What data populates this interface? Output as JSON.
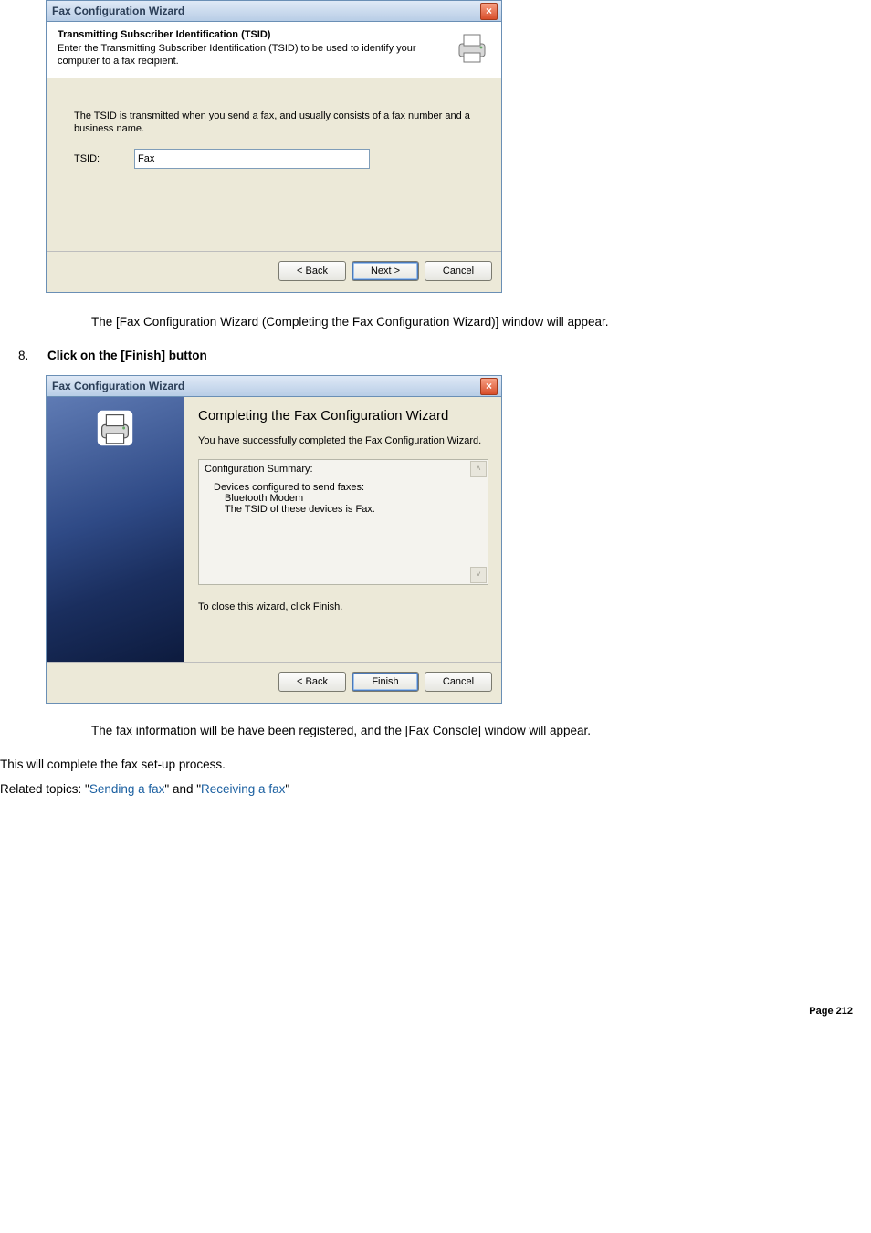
{
  "dialog1": {
    "title": "Fax Configuration Wizard",
    "header_title": "Transmitting Subscriber Identification (TSID)",
    "header_sub": "Enter the Transmitting Subscriber Identification (TSID) to be used to identify your computer to a fax recipient.",
    "body_desc": "The TSID is transmitted when you send a fax, and usually consists of a fax number and a business name.",
    "tsid_label": "TSID:",
    "tsid_value": "Fax",
    "btn_back": "< Back",
    "btn_next": "Next >",
    "btn_cancel": "Cancel"
  },
  "mid_text": "The [Fax Configuration Wizard (Completing the Fax Configuration Wizard)] window will appear.",
  "step8": {
    "num": "8.",
    "text": "Click on the [Finish] button"
  },
  "dialog2": {
    "title": "Fax Configuration Wizard",
    "big": "Completing the Fax Configuration Wizard",
    "sub": "You have successfully completed the Fax Configuration Wizard.",
    "summary_h": "Configuration Summary:",
    "summary_l1": "Devices configured to send faxes:",
    "summary_l2": "Bluetooth Modem",
    "summary_l3": "The TSID of these devices is Fax.",
    "close_note": "To close this wizard, click Finish.",
    "btn_back": "< Back",
    "btn_finish": "Finish",
    "btn_cancel": "Cancel"
  },
  "after_text": "The fax information will be have been registered, and the [Fax Console] window will appear.",
  "conclude": "This will complete the fax set-up process.",
  "related_prefix": "Related topics: \"",
  "related_link1": "Sending a fax",
  "related_mid": "\" and \"",
  "related_link2": "Receiving a fax",
  "related_suffix": "\"",
  "page_no": "Page 212"
}
